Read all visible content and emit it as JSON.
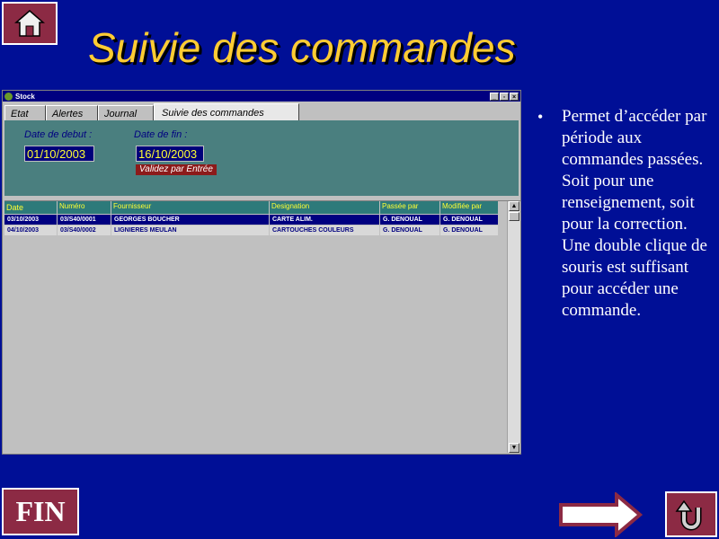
{
  "slide": {
    "title": "Suivie des commandes",
    "bullet_text": "Permet d’accéder par période aux commandes passées. Soit pour une renseignement, soit pour la correction. Une double clique de souris est suffisant pour accéder une commande.",
    "bullet_glyph": "•",
    "fin_label": "FIN"
  },
  "window": {
    "title": "Stock",
    "controls": [
      "_",
      "▫",
      "×"
    ]
  },
  "tabs": [
    "Etat",
    "Alertes",
    "Journal",
    "Suivie des commandes"
  ],
  "form": {
    "start_label": "Date de debut :",
    "end_label": "Date de fin :",
    "start_value": "01/10/2003",
    "end_value": "16/10/2003",
    "hint": "Validez par Entrée"
  },
  "grid": {
    "columns": [
      "Date",
      "Numéro",
      "Fournisseur",
      "Designation",
      "Passée par",
      "Modifiée par"
    ],
    "rows": [
      [
        "03/10/2003",
        "03/S40/0001",
        "GEORGES BOUCHER",
        "CARTE ALIM.",
        "G. DENOUAL",
        "G. DENOUAL"
      ],
      [
        "04/10/2003",
        "03/S40/0002",
        "LIGNIERES MEULAN",
        "CARTOUCHES COULEURS",
        "G. DENOUAL",
        "G. DENOUAL"
      ]
    ],
    "selected_row": 0,
    "scroll_up": "▲",
    "scroll_down": "▼"
  },
  "colors": {
    "background": "#000f96",
    "title": "#ffcc33",
    "nav_button": "#8c2a44",
    "panel": "#4a7f7f",
    "header": "#2d7a7a",
    "input_text": "#ffff33"
  },
  "icons": {
    "home": "home-icon",
    "next": "arrow-right-icon",
    "return": "u-turn-icon"
  }
}
